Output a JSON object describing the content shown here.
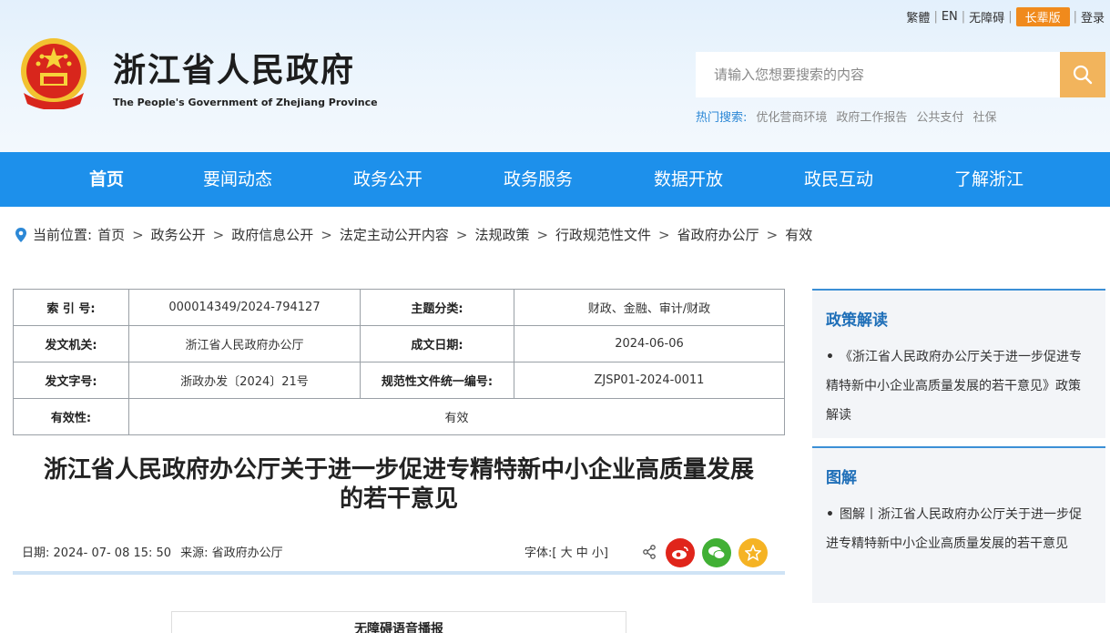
{
  "toplinks": {
    "traditional": "繁體",
    "english": "EN",
    "accessibility": "无障碍",
    "elder": "长辈版",
    "login": "登录"
  },
  "site": {
    "title": "浙江省人民政府",
    "subtitle": "The People's Government of Zhejiang Province"
  },
  "search": {
    "placeholder": "请输入您想要搜索的内容",
    "hot_label": "热门搜索:",
    "hot_items": [
      "优化营商环境",
      "政府工作报告",
      "公共支付",
      "社保"
    ]
  },
  "nav": {
    "items": [
      "首页",
      "要闻动态",
      "政务公开",
      "政务服务",
      "数据开放",
      "政民互动",
      "了解浙江"
    ]
  },
  "breadcrumb": {
    "label": "当前位置:",
    "items": [
      "首页",
      "政务公开",
      "政府信息公开",
      "法定主动公开内容",
      "法规政策",
      "行政规范性文件",
      "省政府办公厅",
      "有效"
    ]
  },
  "meta": {
    "index_label": "索 引 号:",
    "index_value": "000014349/2024-794127",
    "topic_label": "主题分类:",
    "topic_value": "财政、金融、审计/财政",
    "issuer_label": "发文机关:",
    "issuer_value": "浙江省人民政府办公厅",
    "date_label": "成文日期:",
    "date_value": "2024-06-06",
    "docno_label": "发文字号:",
    "docno_value": "浙政办发〔2024〕21号",
    "code_label": "规范性文件统一编号:",
    "code_value": "ZJSP01-2024-0011",
    "validity_label": "有效性:",
    "validity_value": "有效"
  },
  "article": {
    "title_line1": "浙江省人民政府办公厅关于进一步促进专精特新中小企业高质量发展",
    "title_line2": "的若干意见",
    "date_label": "日期:",
    "date_value": "2024- 07- 08 15: 50",
    "source_label": "来源:",
    "source_value": "省政府办公厅",
    "font_label": "字体:[ 大 中 小]",
    "audio_label": "无障碍语音播报"
  },
  "sidebar": {
    "policy_title": "政策解读",
    "policy_item": "《浙江省人民政府办公厅关于进一步促进专精特新中小企业高质量发展的若干意见》政策解读",
    "graphic_title": "图解",
    "graphic_item": "图解丨浙江省人民政府办公厅关于进一步促进专精特新中小企业高质量发展的若干意见"
  },
  "colors": {
    "nav_bg": "#1d90eb",
    "accent_orange": "#f08a1c",
    "search_btn": "#f2b45c",
    "link_blue": "#1f6fb8"
  }
}
